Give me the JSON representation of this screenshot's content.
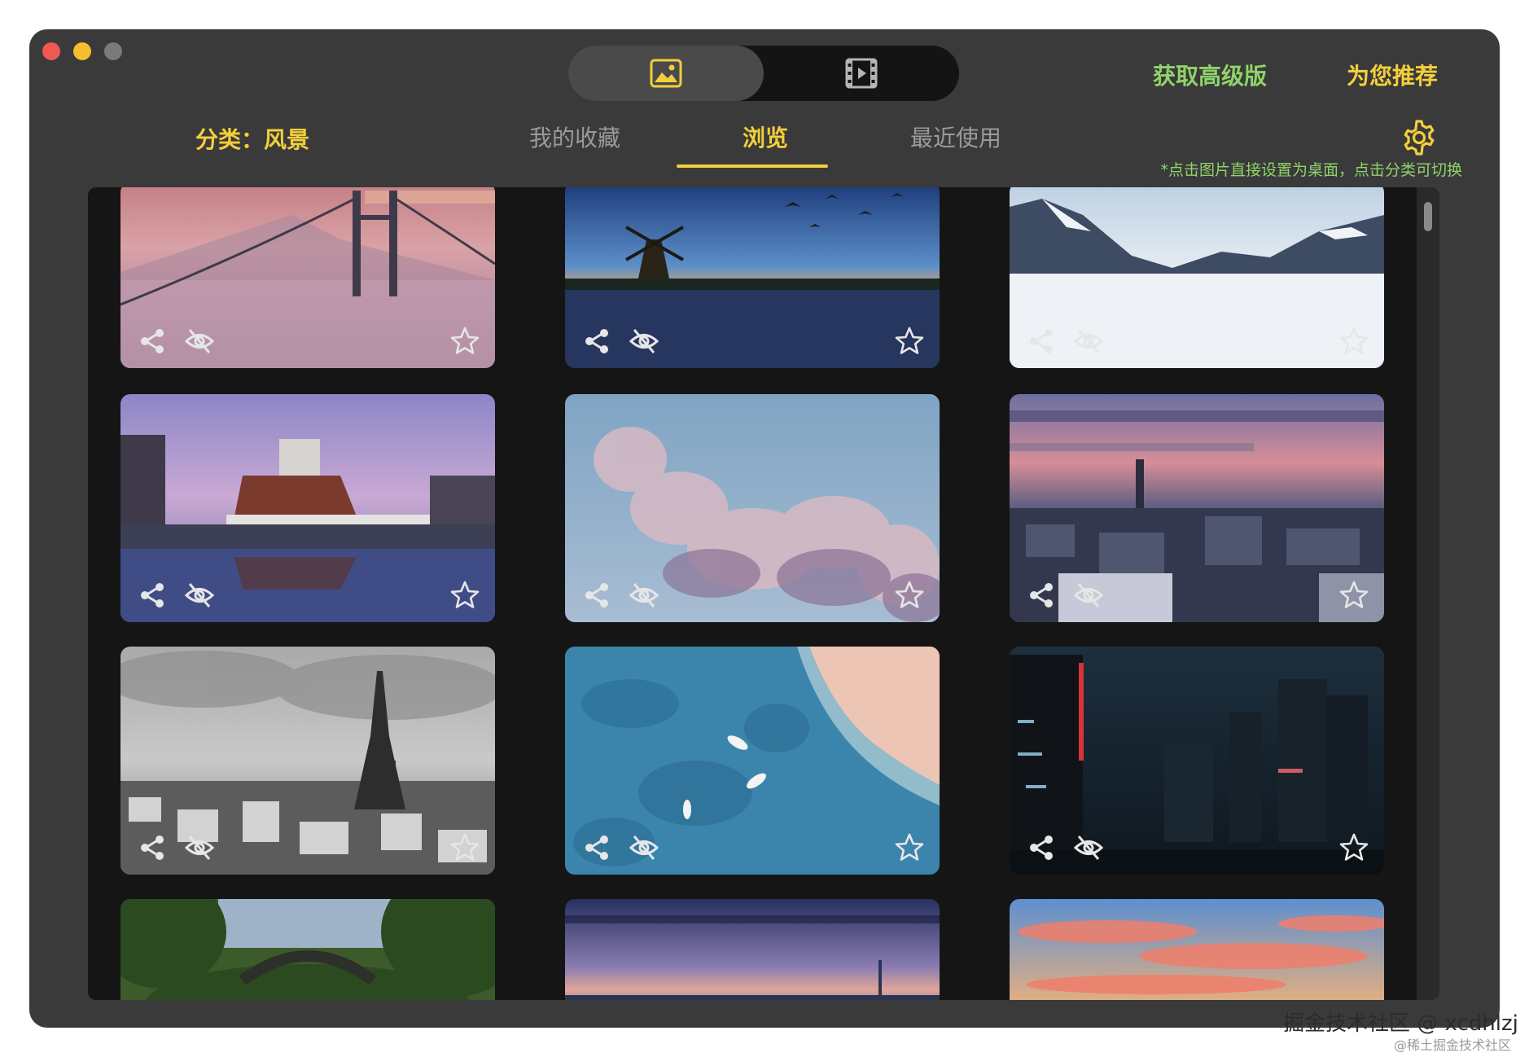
{
  "app": {
    "segments": [
      {
        "icon": "image-icon",
        "active": true
      },
      {
        "icon": "video-icon",
        "active": false
      }
    ],
    "get_premium": "获取高级版",
    "recommend": "为您推荐"
  },
  "filter": {
    "category_label": "分类：风景"
  },
  "tabs": [
    {
      "label": "我的收藏",
      "active": false
    },
    {
      "label": "浏览",
      "active": true
    },
    {
      "label": "最近使用",
      "active": false
    }
  ],
  "hint": "*点击图片直接设置为桌面，点击分类可切换",
  "wallpapers": [
    {
      "subject": "bridge in fog",
      "actions": [
        "share-icon",
        "hide-icon",
        "star-icon"
      ]
    },
    {
      "subject": "windmill at dusk",
      "actions": [
        "share-icon",
        "hide-icon",
        "star-icon"
      ]
    },
    {
      "subject": "snowy mountains",
      "actions": [
        "share-icon",
        "hide-icon",
        "star-icon"
      ]
    },
    {
      "subject": "boat reflection",
      "actions": [
        "share-icon",
        "hide-icon",
        "star-icon"
      ]
    },
    {
      "subject": "clouds",
      "actions": [
        "share-icon",
        "hide-icon",
        "star-icon"
      ]
    },
    {
      "subject": "city sunset",
      "actions": [
        "share-icon",
        "hide-icon",
        "star-icon"
      ]
    },
    {
      "subject": "eiffel tower",
      "actions": [
        "share-icon",
        "hide-icon",
        "star-icon"
      ]
    },
    {
      "subject": "aerial beach",
      "actions": [
        "share-icon",
        "hide-icon",
        "star-icon"
      ]
    },
    {
      "subject": "night city",
      "actions": [
        "share-icon",
        "hide-icon",
        "star-icon"
      ]
    },
    {
      "subject": "forest bridge",
      "actions": []
    },
    {
      "subject": "winter horizon",
      "actions": []
    },
    {
      "subject": "pink sky",
      "actions": []
    }
  ],
  "watermark": "掘金技术社区 @ xcdhlzj",
  "watermark_small": "@稀土掘金技术社区",
  "colors": {
    "accent_yellow": "#f3cf3b",
    "accent_green": "#8fd36a",
    "window_bg": "#3a3a3a",
    "grid_bg": "#151515"
  }
}
